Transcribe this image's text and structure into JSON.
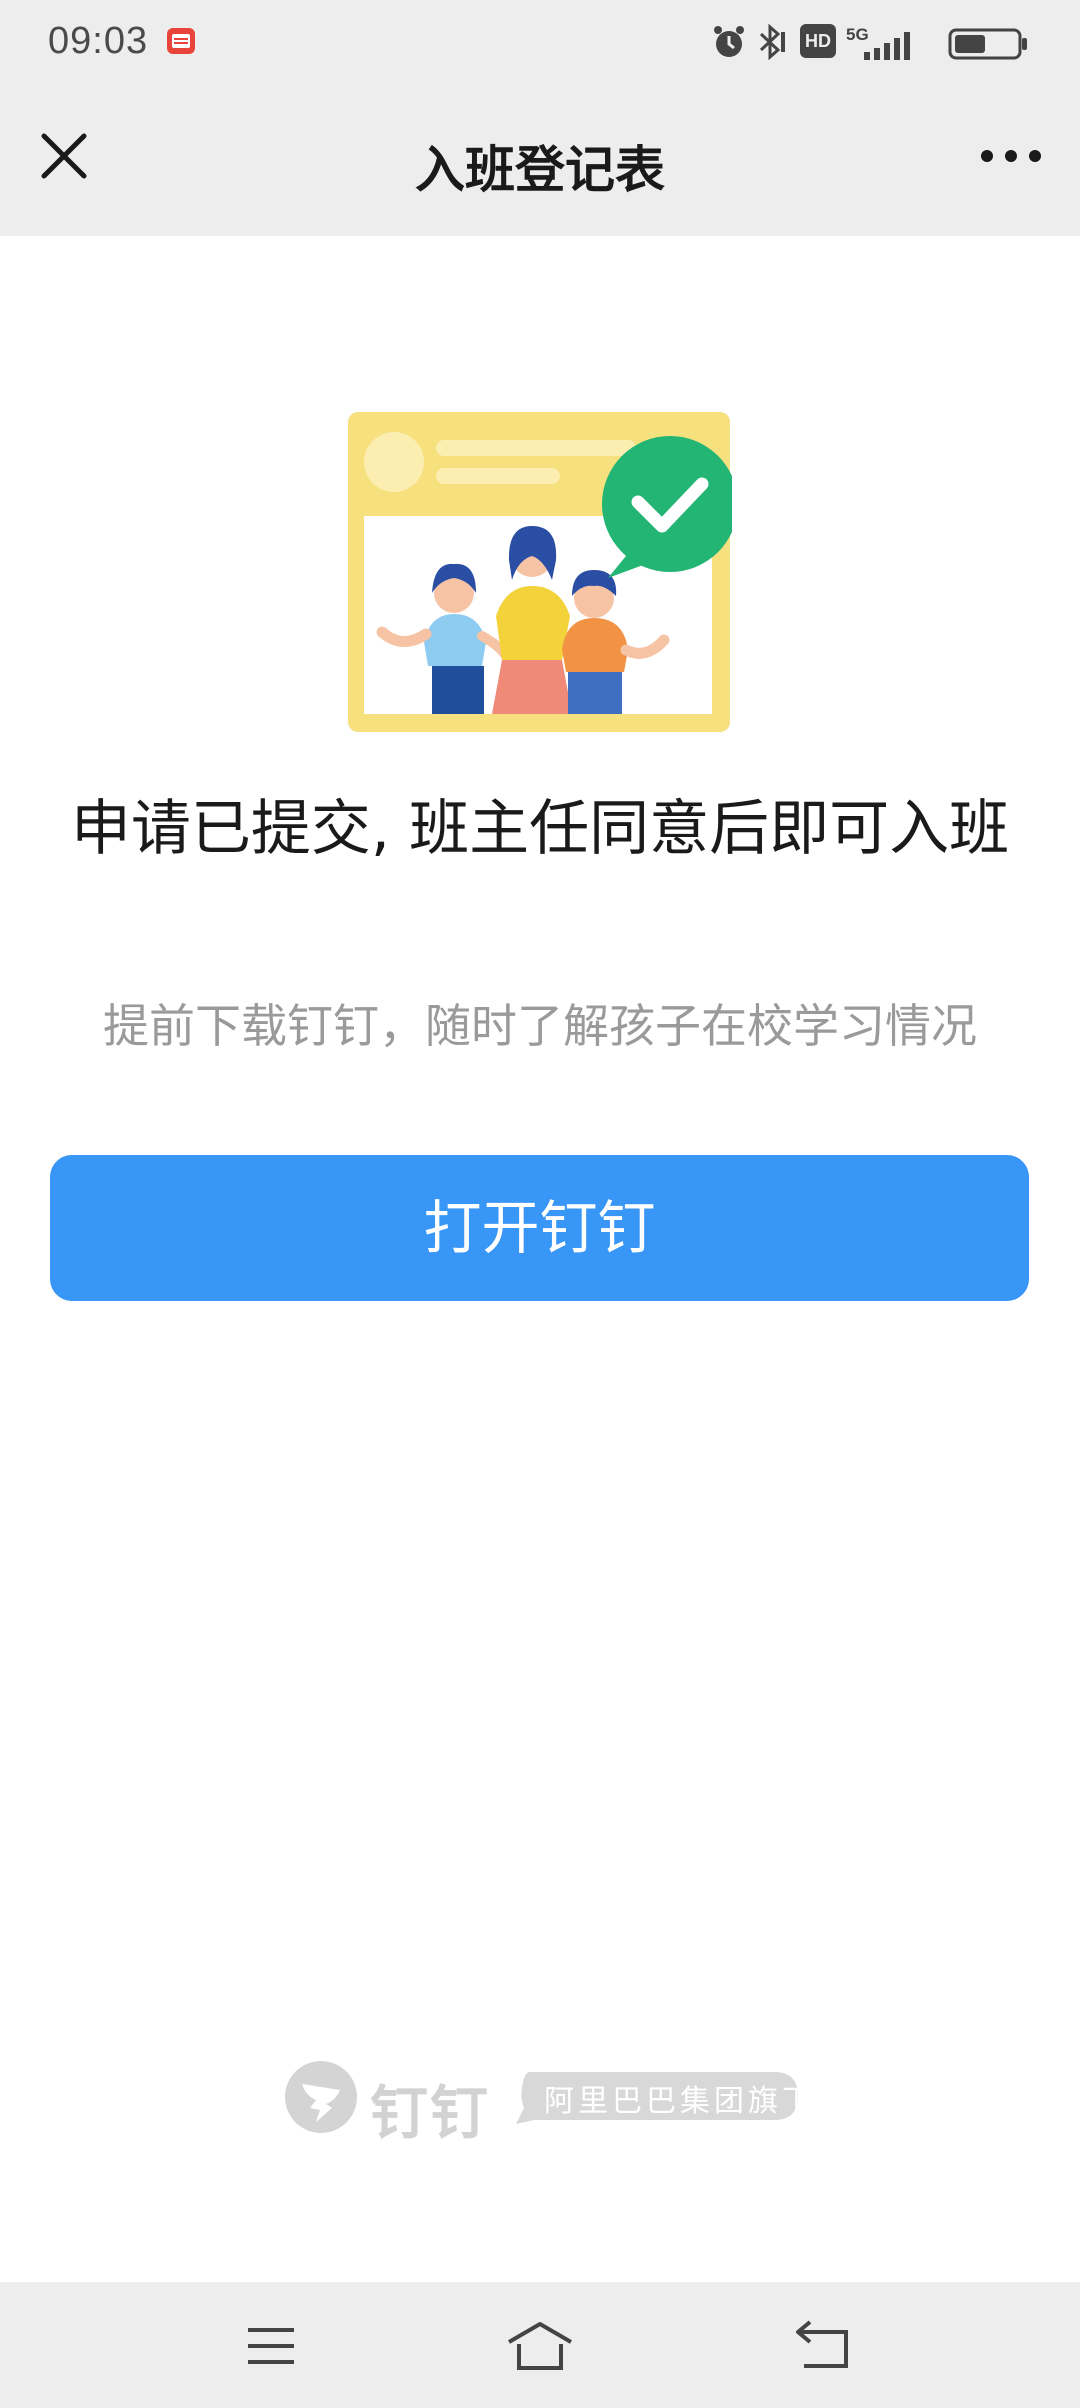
{
  "status_bar": {
    "time": "09:03",
    "icons": [
      "app-notification-icon",
      "alarm-icon",
      "bluetooth-icon",
      "hd-icon",
      "signal-5g-icon",
      "battery-icon"
    ],
    "hd_label": "HD",
    "network_label": "5G",
    "battery_level": 0.5
  },
  "header": {
    "title": "入班登记表",
    "close_icon": "close-icon",
    "more_icon": "more-icon"
  },
  "main": {
    "illustration": "students-checkmark-illustration",
    "headline": "申请已提交, 班主任同意后即可入班",
    "subline": "提前下载钉钉，随时了解孩子在校学习情况",
    "button_label": "打开钉钉"
  },
  "footer": {
    "brand_name": "钉钉",
    "brand_tag": "阿里巴巴集团旗下"
  },
  "nav_bar": {
    "icons": [
      "menu-icon",
      "home-icon",
      "back-icon"
    ]
  },
  "colors": {
    "accent": "#3796f6",
    "bar_bg": "#ededed",
    "check_green": "#22b573"
  }
}
